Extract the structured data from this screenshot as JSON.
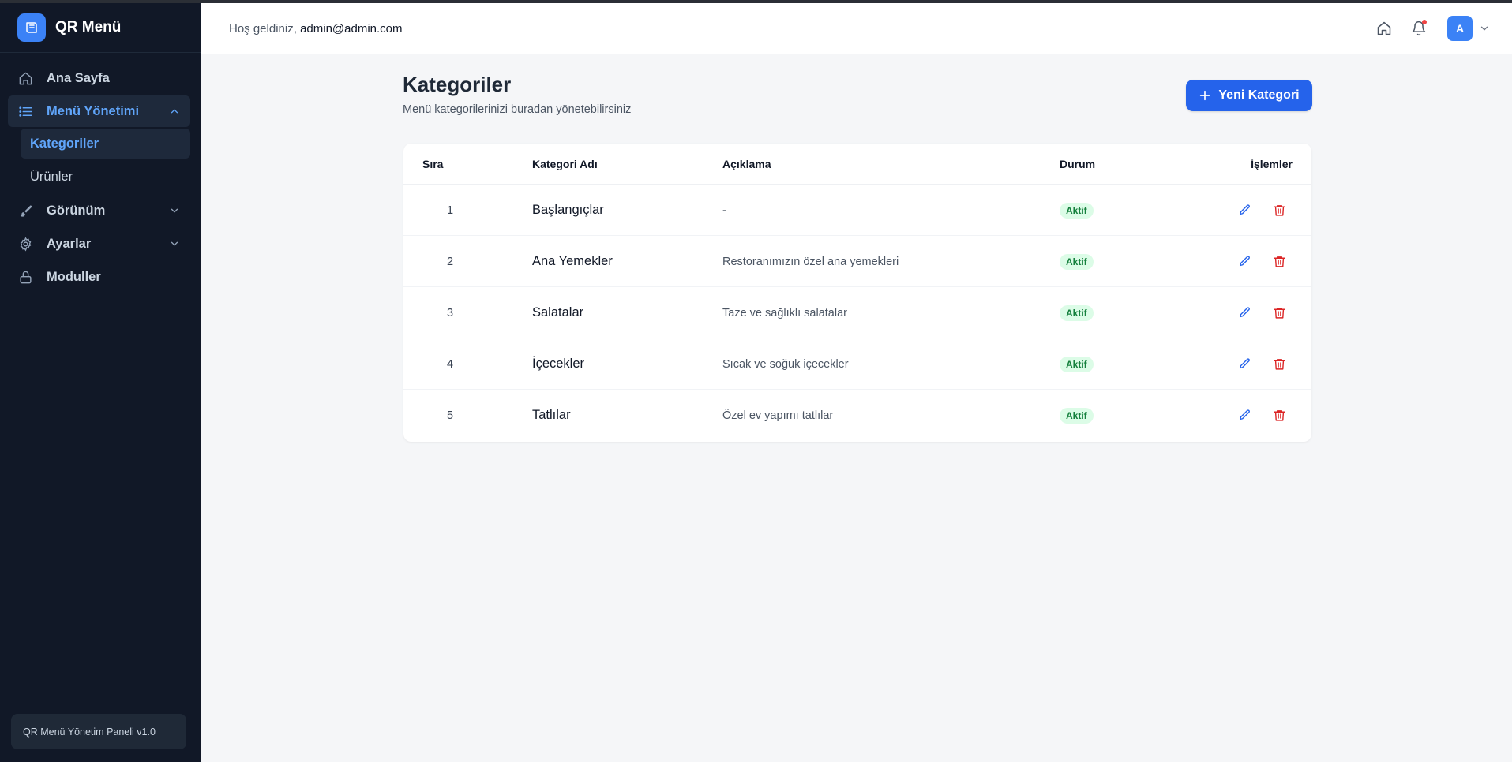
{
  "app": {
    "title": "QR Menü"
  },
  "sidebar": {
    "items": [
      {
        "label": "Ana Sayfa",
        "icon": "home-icon"
      },
      {
        "label": "Menü Yönetimi",
        "icon": "list-icon",
        "expanded": true,
        "children": [
          {
            "label": "Kategoriler",
            "active": true
          },
          {
            "label": "Ürünler"
          }
        ]
      },
      {
        "label": "Görünüm",
        "icon": "brush-icon"
      },
      {
        "label": "Ayarlar",
        "icon": "gear-icon"
      },
      {
        "label": "Moduller",
        "icon": "lock-icon"
      }
    ],
    "footer": "QR Menü Yönetim Paneli v1.0"
  },
  "header": {
    "welcome_prefix": "Hoş geldiniz,",
    "email": "admin@admin.com",
    "avatar_initial": "A",
    "notification_dot_color": "#ef4444"
  },
  "page": {
    "title": "Kategoriler",
    "subtitle": "Menü kategorilerinizi buradan yönetebilirsiniz",
    "new_button": "Yeni Kategori"
  },
  "table": {
    "columns": {
      "sira": "Sıra",
      "name": "Kategori Adı",
      "desc": "Açıklama",
      "status": "Durum",
      "actions": "İşlemler"
    },
    "rows": [
      {
        "sira": "1",
        "name": "Başlangıçlar",
        "desc": "-",
        "status": "Aktif"
      },
      {
        "sira": "2",
        "name": "Ana Yemekler",
        "desc": "Restoranımızın özel ana yemekleri",
        "status": "Aktif"
      },
      {
        "sira": "3",
        "name": "Salatalar",
        "desc": "Taze ve sağlıklı salatalar",
        "status": "Aktif"
      },
      {
        "sira": "4",
        "name": "İçecekler",
        "desc": "Sıcak ve soğuk içecekler",
        "status": "Aktif"
      },
      {
        "sira": "5",
        "name": "Tatlılar",
        "desc": "Özel ev yapımı tatlılar",
        "status": "Aktif"
      }
    ]
  },
  "colors": {
    "accent": "#2563eb",
    "sidebar_bg": "#111827",
    "active_text": "#60a5fa",
    "delete": "#dc2626"
  }
}
